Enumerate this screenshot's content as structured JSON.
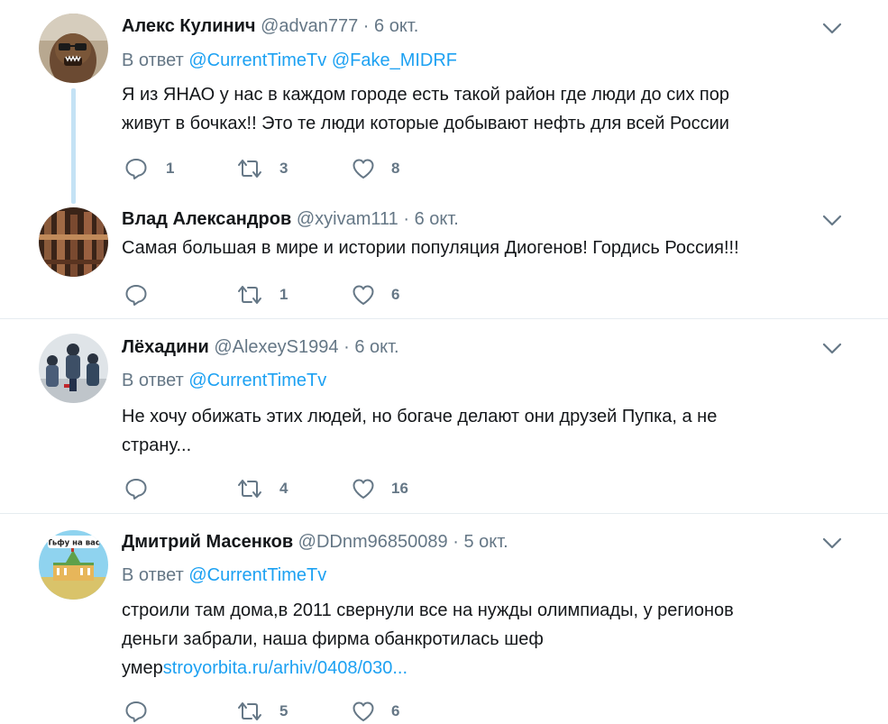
{
  "tweets": [
    {
      "name": "Алекс Кулинич",
      "handle": "@advan777",
      "sep": "·",
      "time": "6 окт.",
      "reply_prefix": "В ответ",
      "mentions": [
        "@CurrentTimeTv",
        "@Fake_MIDRF"
      ],
      "text_lines": [
        "Я из ЯНАО у нас в каждом городе есть такой район где люди до сих пор",
        "живут в бочках!! Это те люди которые добывают нефть для всей России"
      ],
      "replies": "1",
      "retweets": "3",
      "likes": "8"
    },
    {
      "name": "Влад Александров",
      "handle": "@xyivam111",
      "sep": "·",
      "time": "6 окт.",
      "text_lines": [
        "Самая большая в мире и истории популяция Диогенов! Гордись Россия!!!"
      ],
      "replies": "",
      "retweets": "1",
      "likes": "6"
    },
    {
      "name": "Лёхадини",
      "handle": "@AlexeyS1994",
      "sep": "·",
      "time": "6 окт.",
      "reply_prefix": "В ответ",
      "mentions": [
        "@CurrentTimeTv"
      ],
      "text_lines": [
        "Не хочу обижать этих людей, но богаче делают они друзей Пупка, а не",
        "страну..."
      ],
      "replies": "",
      "retweets": "4",
      "likes": "16"
    },
    {
      "name": "Дмитрий Масенков",
      "handle": "@DDnm96850089",
      "sep": "·",
      "time": "5 окт.",
      "reply_prefix": "В ответ",
      "mentions": [
        "@CurrentTimeTv"
      ],
      "text_lines": [
        "строили там дома,в 2011 свернули все на нужды олимпиады, у регионов",
        "деньги забрали, наша фирма обанкротилась шеф"
      ],
      "text_last_plain": "умер",
      "text_last_link": "stroyorbita.ru/arhiv/0408/030...",
      "replies": "",
      "retweets": "5",
      "likes": "6",
      "avatar_label": "Тьфу на вас"
    }
  ],
  "icons": {
    "reply": "reply-bubble-icon",
    "retweet": "retweet-icon",
    "like": "heart-icon",
    "menu": "chevron-down-icon"
  },
  "colors": {
    "link": "#1da1f2",
    "secondary_text": "#657786",
    "thread_line": "#c4e2f5",
    "divider": "#e6ecf0"
  }
}
